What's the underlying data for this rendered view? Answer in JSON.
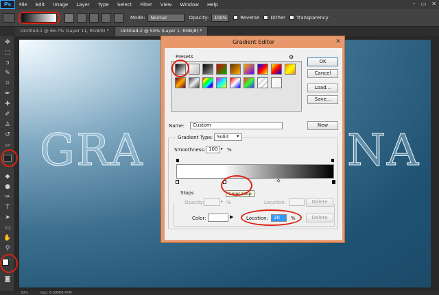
{
  "app": {
    "logo": "Ps"
  },
  "menubar": {
    "items": [
      "File",
      "Edit",
      "Image",
      "Layer",
      "Type",
      "Select",
      "Filter",
      "View",
      "Window",
      "Help"
    ],
    "win_controls": [
      "–",
      "▭",
      "✕"
    ]
  },
  "options": {
    "mode_label": "Mode:",
    "mode_value": "Normal",
    "opacity_label": "Opacity:",
    "opacity_value": "100%",
    "reverse_label": "Reverse",
    "dither_label": "Dither",
    "transparency_label": "Transparency"
  },
  "tabs": [
    {
      "label": "Untitled-1 @ 66.7% (Layer 11, RGB/8) *"
    },
    {
      "label": "Untitled-2 @ 50% (Layer 1, RGB/8) *"
    }
  ],
  "canvas": {
    "text_left": "GRA",
    "text_right": "NA"
  },
  "status": {
    "zoom": "50%",
    "doc": "Doc: 6.59M/8.47M"
  },
  "dialog": {
    "title": "Gradient Editor",
    "close_glyph": "✕",
    "presets_label": "Presets",
    "ok_label": "OK",
    "cancel_label": "Cancel",
    "load_label": "Load...",
    "save_label": "Save...",
    "name_label": "Name:",
    "name_value": "Custom",
    "new_label": "New",
    "gradient_type_label": "Gradient Type:",
    "gradient_type_value": "Solid",
    "smoothness_label": "Smoothness:",
    "smoothness_value": "100",
    "percent": "%",
    "stops_label": "Stops",
    "opacity_label": "Opacity:",
    "location_label": "Location:",
    "delete_label": "Delete",
    "color_label": "Color:",
    "location_value": "30",
    "tooltip": "Color Stop"
  },
  "colors": {
    "highlight": "#d21a1a",
    "dialog_border": "#e8986a"
  }
}
